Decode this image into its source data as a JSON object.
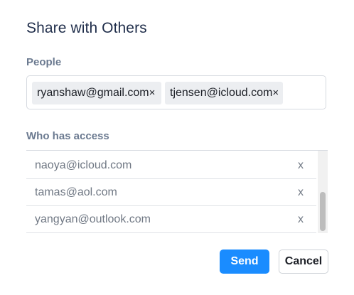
{
  "dialog": {
    "title": "Share with Others"
  },
  "people": {
    "label": "People",
    "chips": [
      {
        "email": "ryanshaw@gmail.com",
        "remove": "×"
      },
      {
        "email": "tjensen@icloud.com",
        "remove": "×"
      }
    ]
  },
  "access": {
    "label": "Who has access",
    "rows": [
      {
        "email": "naoya@icloud.com",
        "remove": "x"
      },
      {
        "email": "tamas@aol.com",
        "remove": "x"
      },
      {
        "email": "yangyan@outlook.com",
        "remove": "x"
      }
    ]
  },
  "actions": {
    "send_label": "Send",
    "cancel_label": "Cancel"
  },
  "colors": {
    "accent": "#1a8cff",
    "title": "#1f2d4a",
    "section_label": "#6b7a90"
  }
}
